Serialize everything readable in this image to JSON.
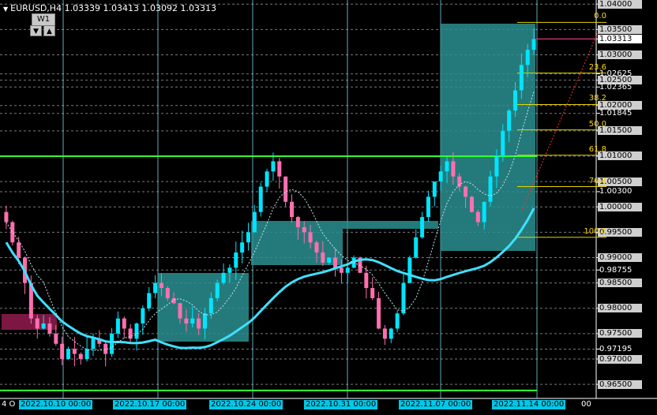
{
  "header": {
    "symbol_info": "EURUSD,H4  1.03339 1.03413 1.03092 1.03313",
    "timeframe_badge": "W1",
    "arrow_down": "▼",
    "arrow_up": "▲"
  },
  "price_axis": {
    "labels": [
      "1.04000",
      "1.03500",
      "1.03313",
      "1.03000",
      "1.02625",
      "1.02500",
      "1.02365",
      "1.02000",
      "1.01845",
      "1.01500",
      "1.01000",
      "1.00500",
      "1.00300",
      "1.00000",
      "0.99500",
      "0.99000",
      "0.98755",
      "0.98500",
      "0.98000",
      "0.97500",
      "0.97195",
      "0.97000",
      "0.96500"
    ],
    "current_price": "1.03313"
  },
  "fibonacci": {
    "levels": [
      {
        "label": "0.0",
        "price": 1.0364
      },
      {
        "label": "23.6",
        "price": 1.0264
      },
      {
        "label": "38.2",
        "price": 1.0202
      },
      {
        "label": "50.0",
        "price": 1.0152
      },
      {
        "label": "61.8",
        "price": 1.0102
      },
      {
        "label": "76.4",
        "price": 1.004
      },
      {
        "label": "100.0",
        "price": 0.994
      }
    ]
  },
  "time_axis": {
    "labels": [
      "2022.10.10 00:00",
      "2022.10.17 00:00",
      "2022.10.24 00:00",
      "2022.10.31 00:00",
      "2022.11.07 00:00",
      "2022.11.14 00:00"
    ],
    "partial_left": "4 O",
    "partial_right": "00"
  },
  "colors": {
    "bull": "#00e5ff",
    "bear": "#ff6fb0",
    "ma": "#3fe0ff",
    "box": "#2a8f8f",
    "level_line": "#33ff33",
    "fib": "#e6d400"
  },
  "chart_data": {
    "type": "candlestick",
    "symbol": "EURUSD",
    "timeframe": "H4",
    "ylim": [
      0.963,
      1.0405
    ],
    "horizontal_levels": [
      1.01,
      0.9638
    ],
    "close_series": [
      0.997,
      0.993,
      0.99,
      0.985,
      0.978,
      0.976,
      0.977,
      0.975,
      0.973,
      0.97,
      0.972,
      0.971,
      0.97,
      0.972,
      0.974,
      0.973,
      0.971,
      0.975,
      0.978,
      0.976,
      0.974,
      0.977,
      0.98,
      0.983,
      0.985,
      0.984,
      0.982,
      0.981,
      0.978,
      0.977,
      0.978,
      0.976,
      0.979,
      0.982,
      0.985,
      0.987,
      0.988,
      0.991,
      0.993,
      0.995,
      0.999,
      1.004,
      1.007,
      1.009,
      1.006,
      1.001,
      0.998,
      0.996,
      0.995,
      0.993,
      0.991,
      0.989,
      0.99,
      0.988,
      0.987,
      0.988,
      0.99,
      0.987,
      0.984,
      0.982,
      0.976,
      0.974,
      0.976,
      0.979,
      0.985,
      0.99,
      0.994,
      0.998,
      1.002,
      1.005,
      1.007,
      1.009,
      1.006,
      1.004,
      1.002,
      0.999,
      0.997,
      1.001,
      1.006,
      1.01,
      1.015,
      1.019,
      1.023,
      1.028,
      1.031,
      1.0331
    ]
  }
}
